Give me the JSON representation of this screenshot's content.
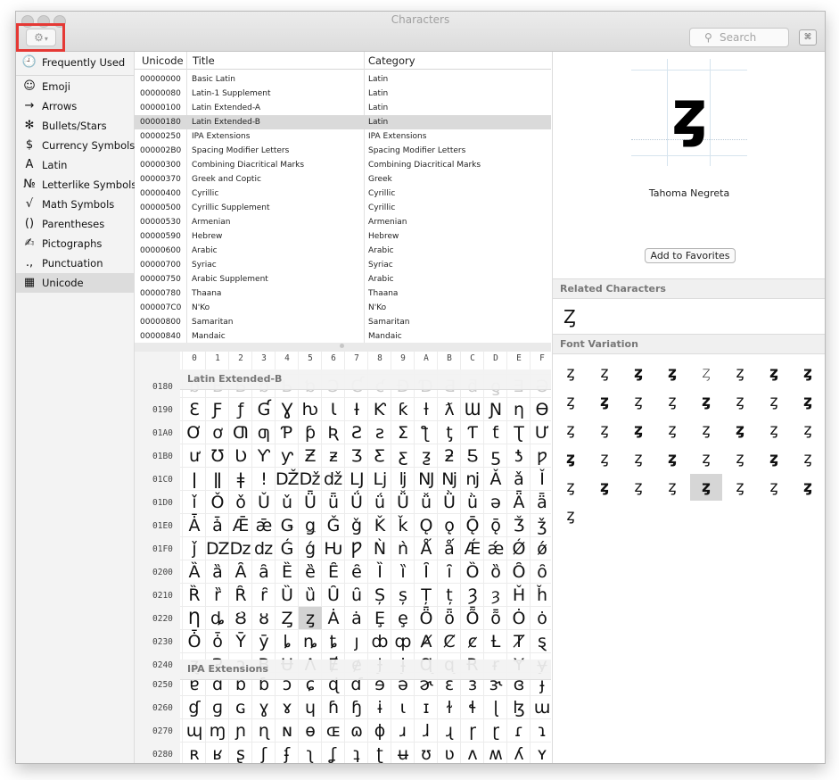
{
  "window": {
    "title": "Characters"
  },
  "search": {
    "placeholder": "Search"
  },
  "sidebar": {
    "items": [
      {
        "label": "Frequently Used",
        "icon": "clock-icon",
        "glyph": "🕘"
      },
      {
        "label": "Emoji",
        "icon": "smiley-icon",
        "glyph": "☺"
      },
      {
        "label": "Arrows",
        "icon": "arrow-icon",
        "glyph": "→"
      },
      {
        "label": "Bullets/Stars",
        "icon": "star-icon",
        "glyph": "✻"
      },
      {
        "label": "Currency Symbols",
        "icon": "dollar-icon",
        "glyph": "$"
      },
      {
        "label": "Latin",
        "icon": "latin-a-icon",
        "glyph": "A"
      },
      {
        "label": "Letterlike Symbols",
        "icon": "numero-icon",
        "glyph": "№"
      },
      {
        "label": "Math Symbols",
        "icon": "sqrt-icon",
        "glyph": "√"
      },
      {
        "label": "Parentheses",
        "icon": "parentheses-icon",
        "glyph": "()"
      },
      {
        "label": "Pictographs",
        "icon": "pen-icon",
        "glyph": "✍"
      },
      {
        "label": "Punctuation",
        "icon": "punctuation-icon",
        "glyph": ".,"
      },
      {
        "label": "Unicode",
        "icon": "grid-icon",
        "glyph": "▦"
      }
    ]
  },
  "blocks": {
    "headers": [
      "Unicode",
      "Title",
      "Category"
    ],
    "rows": [
      [
        "00000000",
        "Basic Latin",
        "Latin"
      ],
      [
        "00000080",
        "Latin-1 Supplement",
        "Latin"
      ],
      [
        "00000100",
        "Latin Extended-A",
        "Latin"
      ],
      [
        "00000180",
        "Latin Extended-B",
        "Latin"
      ],
      [
        "00000250",
        "IPA Extensions",
        "IPA Extensions"
      ],
      [
        "000002B0",
        "Spacing Modifier Letters",
        "Spacing Modifier Letters"
      ],
      [
        "00000300",
        "Combining Diacritical Marks",
        "Combining Diacritical Marks"
      ],
      [
        "00000370",
        "Greek and Coptic",
        "Greek"
      ],
      [
        "00000400",
        "Cyrillic",
        "Cyrillic"
      ],
      [
        "00000500",
        "Cyrillic Supplement",
        "Cyrillic"
      ],
      [
        "00000530",
        "Armenian",
        "Armenian"
      ],
      [
        "00000590",
        "Hebrew",
        "Hebrew"
      ],
      [
        "00000600",
        "Arabic",
        "Arabic"
      ],
      [
        "00000700",
        "Syriac",
        "Syriac"
      ],
      [
        "00000750",
        "Arabic Supplement",
        "Arabic"
      ],
      [
        "00000780",
        "Thaana",
        "Thaana"
      ],
      [
        "000007C0",
        "N'Ko",
        "N'Ko"
      ],
      [
        "00000800",
        "Samaritan",
        "Samaritan"
      ],
      [
        "00000840",
        "Mandaic",
        "Mandaic"
      ]
    ]
  },
  "grid": {
    "hex_cols": [
      "0",
      "1",
      "2",
      "3",
      "4",
      "5",
      "6",
      "7",
      "8",
      "9",
      "A",
      "B",
      "C",
      "D",
      "E",
      "F"
    ],
    "sections": [
      {
        "title": "Latin Extended-B",
        "rows": [
          {
            "label": "0180",
            "chars": [
              "ƀ",
              "Ɓ",
              "Ƃ",
              "ƃ",
              "Ƅ",
              "ƅ",
              "Ɔ",
              "Ƈ",
              "ƈ",
              "Ɖ",
              "Ɗ",
              "Ƌ",
              "ƌ",
              "ƍ",
              "Ǝ",
              "Ə"
            ]
          },
          {
            "label": "0190",
            "chars": [
              "Ɛ",
              "Ƒ",
              "ƒ",
              "Ɠ",
              "Ɣ",
              "ƕ",
              "Ɩ",
              "Ɨ",
              "Ƙ",
              "ƙ",
              "ƚ",
              "ƛ",
              "Ɯ",
              "Ɲ",
              "ƞ",
              "Ɵ"
            ]
          },
          {
            "label": "01A0",
            "chars": [
              "Ơ",
              "ơ",
              "Ƣ",
              "ƣ",
              "Ƥ",
              "ƥ",
              "Ʀ",
              "Ƨ",
              "ƨ",
              "Ʃ",
              "ƪ",
              "ƫ",
              "Ƭ",
              "ƭ",
              "Ʈ",
              "Ư"
            ]
          },
          {
            "label": "01B0",
            "chars": [
              "ư",
              "Ʊ",
              "Ʋ",
              "Ƴ",
              "ƴ",
              "Ƶ",
              "ƶ",
              "Ʒ",
              "Ƹ",
              "ƹ",
              "ƺ",
              "ƻ",
              "Ƽ",
              "ƽ",
              "ƾ",
              "ƿ"
            ]
          },
          {
            "label": "01C0",
            "chars": [
              "ǀ",
              "ǁ",
              "ǂ",
              "ǃ",
              "Ǆ",
              "ǅ",
              "ǆ",
              "Ǉ",
              "ǈ",
              "ǉ",
              "Ǌ",
              "ǋ",
              "ǌ",
              "Ǎ",
              "ǎ",
              "Ǐ"
            ]
          },
          {
            "label": "01D0",
            "chars": [
              "ǐ",
              "Ǒ",
              "ǒ",
              "Ǔ",
              "ǔ",
              "Ǖ",
              "ǖ",
              "Ǘ",
              "ǘ",
              "Ǚ",
              "ǚ",
              "Ǜ",
              "ǜ",
              "ǝ",
              "Ǟ",
              "ǟ"
            ]
          },
          {
            "label": "01E0",
            "chars": [
              "Ǡ",
              "ǡ",
              "Ǣ",
              "ǣ",
              "Ǥ",
              "ǥ",
              "Ǧ",
              "ǧ",
              "Ǩ",
              "ǩ",
              "Ǫ",
              "ǫ",
              "Ǭ",
              "ǭ",
              "Ǯ",
              "ǯ"
            ]
          },
          {
            "label": "01F0",
            "chars": [
              "ǰ",
              "Ǳ",
              "ǲ",
              "ǳ",
              "Ǵ",
              "ǵ",
              "Ƕ",
              "Ƿ",
              "Ǹ",
              "ǹ",
              "Ǻ",
              "ǻ",
              "Ǽ",
              "ǽ",
              "Ǿ",
              "ǿ"
            ]
          },
          {
            "label": "0200",
            "chars": [
              "Ȁ",
              "ȁ",
              "Ȃ",
              "ȃ",
              "Ȅ",
              "ȅ",
              "Ȇ",
              "ȇ",
              "Ȉ",
              "ȉ",
              "Ȋ",
              "ȋ",
              "Ȍ",
              "ȍ",
              "Ȏ",
              "ȏ"
            ]
          },
          {
            "label": "0210",
            "chars": [
              "Ȑ",
              "ȑ",
              "Ȓ",
              "ȓ",
              "Ȕ",
              "ȕ",
              "Ȗ",
              "ȗ",
              "Ș",
              "ș",
              "Ț",
              "ț",
              "Ȝ",
              "ȝ",
              "Ȟ",
              "ȟ"
            ]
          },
          {
            "label": "0220",
            "chars": [
              "Ƞ",
              "ȡ",
              "Ȣ",
              "ȣ",
              "Ȥ",
              "ȥ",
              "Ȧ",
              "ȧ",
              "Ȩ",
              "ȩ",
              "Ȫ",
              "ȫ",
              "Ȭ",
              "ȭ",
              "Ȯ",
              "ȯ"
            ]
          },
          {
            "label": "0230",
            "chars": [
              "Ȱ",
              "ȱ",
              "Ȳ",
              "ȳ",
              "ȴ",
              "ȵ",
              "ȶ",
              "ȷ",
              "ȸ",
              "ȹ",
              "Ⱥ",
              "Ȼ",
              "ȼ",
              "Ƚ",
              "Ⱦ",
              "ȿ"
            ]
          },
          {
            "label": "0240",
            "chars": [
              "ɀ",
              "Ɂ",
              "ɂ",
              "Ƀ",
              "Ʉ",
              "Ʌ",
              "Ɇ",
              "ɇ",
              "Ɉ",
              "ɉ",
              "Ɋ",
              "ɋ",
              "Ɍ",
              "ɍ",
              "Ɏ",
              "ɏ"
            ]
          }
        ]
      },
      {
        "title": "IPA Extensions",
        "rows": [
          {
            "label": "0250",
            "chars": [
              "ɐ",
              "ɑ",
              "ɒ",
              "ɓ",
              "ɔ",
              "ɕ",
              "ɖ",
              "ɗ",
              "ɘ",
              "ə",
              "ɚ",
              "ɛ",
              "ɜ",
              "ɝ",
              "ɞ",
              "ɟ"
            ]
          },
          {
            "label": "0260",
            "chars": [
              "ɠ",
              "ɡ",
              "ɢ",
              "ɣ",
              "ɤ",
              "ɥ",
              "ɦ",
              "ɧ",
              "ɨ",
              "ɩ",
              "ɪ",
              "ɫ",
              "ɬ",
              "ɭ",
              "ɮ",
              "ɯ"
            ]
          },
          {
            "label": "0270",
            "chars": [
              "ɰ",
              "ɱ",
              "ɲ",
              "ɳ",
              "ɴ",
              "ɵ",
              "ɶ",
              "ɷ",
              "ɸ",
              "ɹ",
              "ɺ",
              "ɻ",
              "ɼ",
              "ɽ",
              "ɾ",
              "ɿ"
            ]
          },
          {
            "label": "0280",
            "chars": [
              "ʀ",
              "ʁ",
              "ʂ",
              "ʃ",
              "ʄ",
              "ʅ",
              "ʆ",
              "ʇ",
              "ʈ",
              "ʉ",
              "ʊ",
              "ʋ",
              "ʌ",
              "ʍ",
              "ʎ",
              "ʏ"
            ]
          }
        ]
      }
    ],
    "selected_char": "ȥ"
  },
  "detail": {
    "char": "ȥ",
    "font_name": "Tahoma Negreta",
    "favorites_label": "Add to Favorites",
    "related_header": "Related Characters",
    "related_chars": "Ȥ",
    "variation_header": "Font Variation",
    "variations": [
      "ȥ",
      "ȥ",
      "ȥ",
      "ȥ",
      "ȥ",
      "ȥ",
      "ȥ",
      "ȥ",
      "ȥ",
      "ȥ",
      "ȥ",
      "ȥ",
      "ȥ",
      "ȥ",
      "ȥ",
      "ȥ",
      "ȥ",
      "ȥ",
      "ȥ",
      "ȥ",
      "ȥ",
      "ȥ",
      "ȥ",
      "ȥ",
      "ȥ",
      "ȥ",
      "ȥ",
      "ȥ",
      "ȥ",
      "ȥ",
      "ȥ",
      "ȥ",
      "ȥ",
      "ȥ",
      "ȥ",
      "ȥ",
      "ȥ",
      "ȥ",
      "ȥ",
      "ȥ",
      "ȥ"
    ]
  }
}
